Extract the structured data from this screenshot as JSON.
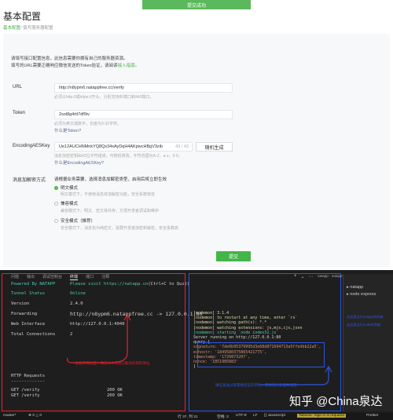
{
  "toast": "提交成功",
  "title": "基本配置",
  "breadcrumb": {
    "link": "基本配置",
    "sep": "/",
    "current": "填写服务器配置"
  },
  "intro": {
    "line1": "请填写接口配置信息，此信息需要你拥有自己的服务器资源。",
    "line2_pre": "填写的URL需要正确响应微信发送的Token验证，请阅读",
    "line2_link": "接入指南。"
  },
  "fields": {
    "url": {
      "label": "URL",
      "value": "http://n8ypm6.natappfree.cc/verify",
      "hint": "必须以http://或https://开头，分别支持80端口和443端口。"
    },
    "token": {
      "label": "Token",
      "value": "2sol8g4rtt7df9iv",
      "hint": "必须为英文或数字，长度为3-32字符。",
      "link": "什么是Token?"
    },
    "aeskey": {
      "label": "EncodingAESKey",
      "value": "Ue12AUCHNMnkYQ8Qx34xAyDqH4AKpwcHBgV3zib",
      "count": "43 / 43",
      "button": "随机生成",
      "hint": "消息加密密钥由43位字符组成，可随机修改，字符范围为A-Z，a-z，0-9。",
      "link": "什么是EncodingAESKey?"
    },
    "encryption": {
      "label": "消息加解密方式",
      "prompt": "请根据业务需要，选择消息加解密类型，启用后将立即生效",
      "options": [
        {
          "label": "明文模式",
          "desc": "明文模式下，不使用消息体加解密功能，安全系数较低",
          "selected": true
        },
        {
          "label": "兼容模式",
          "desc": "兼容模式下，明文、密文将共存，方便开发者调试和维护",
          "selected": false
        },
        {
          "label": "安全模式（推荐）",
          "desc": "安全模式下，消息包为纯密文，需要开发者加密和解密，安全系数高",
          "selected": false
        }
      ]
    }
  },
  "submit": "提交",
  "ide": {
    "tabs": [
      "问题",
      "输出",
      "调试控制台",
      "终端",
      "端口",
      "注释"
    ],
    "active_tab": "终端",
    "natapp": {
      "header_left": "Powered By NATAPP",
      "header_right": "Please visit https://natapp.cn",
      "header_quit": "(Ctrl+C to Quit)",
      "rows": [
        {
          "k": "Tunnel Status",
          "v": "Online"
        },
        {
          "k": "Version",
          "v": "2.4.0"
        },
        {
          "k": "Forwarding",
          "v": "http://n8ypm6.natappfree.cc -> 127.0.0.1:80"
        },
        {
          "k": "Web Interface",
          "v": "http://127.0.0.1:4040"
        },
        {
          "k": "Total Connections",
          "v": "2"
        }
      ],
      "http_title": "HTTP Requests",
      "http_sep": "-------------",
      "requests": [
        {
          "method": "GET /verify",
          "status": "200 OK"
        },
        {
          "method": "GET /verify",
          "status": "200 OK"
        }
      ]
    },
    "nodemon": [
      "[nodemon] 3.1.4",
      "[nodemon] to restart at any time, enter `rs`",
      "[nodemon] watching path(s): *.*",
      "[nodemon] watching extensions: js,mjs,cjs,json",
      "[nodemon] starting `node index32.js`",
      "Server running on http://127.0.0.1:80",
      "query {",
      "  signature: '7de0b95379995d3e68d871694713a5ffedbb22a5',",
      "  echostr: '1849580375865421775',",
      "  timestamp: '1720873207',",
      "  nonce: '1851985883'",
      "}"
    ],
    "annotations": {
      "red": "此处的网址是，微信公众号接口能访问到的地址",
      "blue_bottom": "微信发送过来需要验证的参数，需要我们处理并返回",
      "blue_right1": "左边是运行natapp的终端",
      "blue_right2": "右边是运行node的终端"
    },
    "panel_title": "natapp - natapp",
    "processes": [
      "natapp",
      "node express"
    ],
    "status": {
      "branch": "master*",
      "sync": "⊗ 0 △ 0",
      "pos": "行 37, 列 31",
      "spaces": "空格: 2",
      "enc": "UTF-8",
      "eol": "LF",
      "lang": "{} JavaScript",
      "tabnine": "Tabnine: Sign in is required",
      "prettier": "Prettier"
    }
  },
  "watermark": "知乎 @China泉达"
}
